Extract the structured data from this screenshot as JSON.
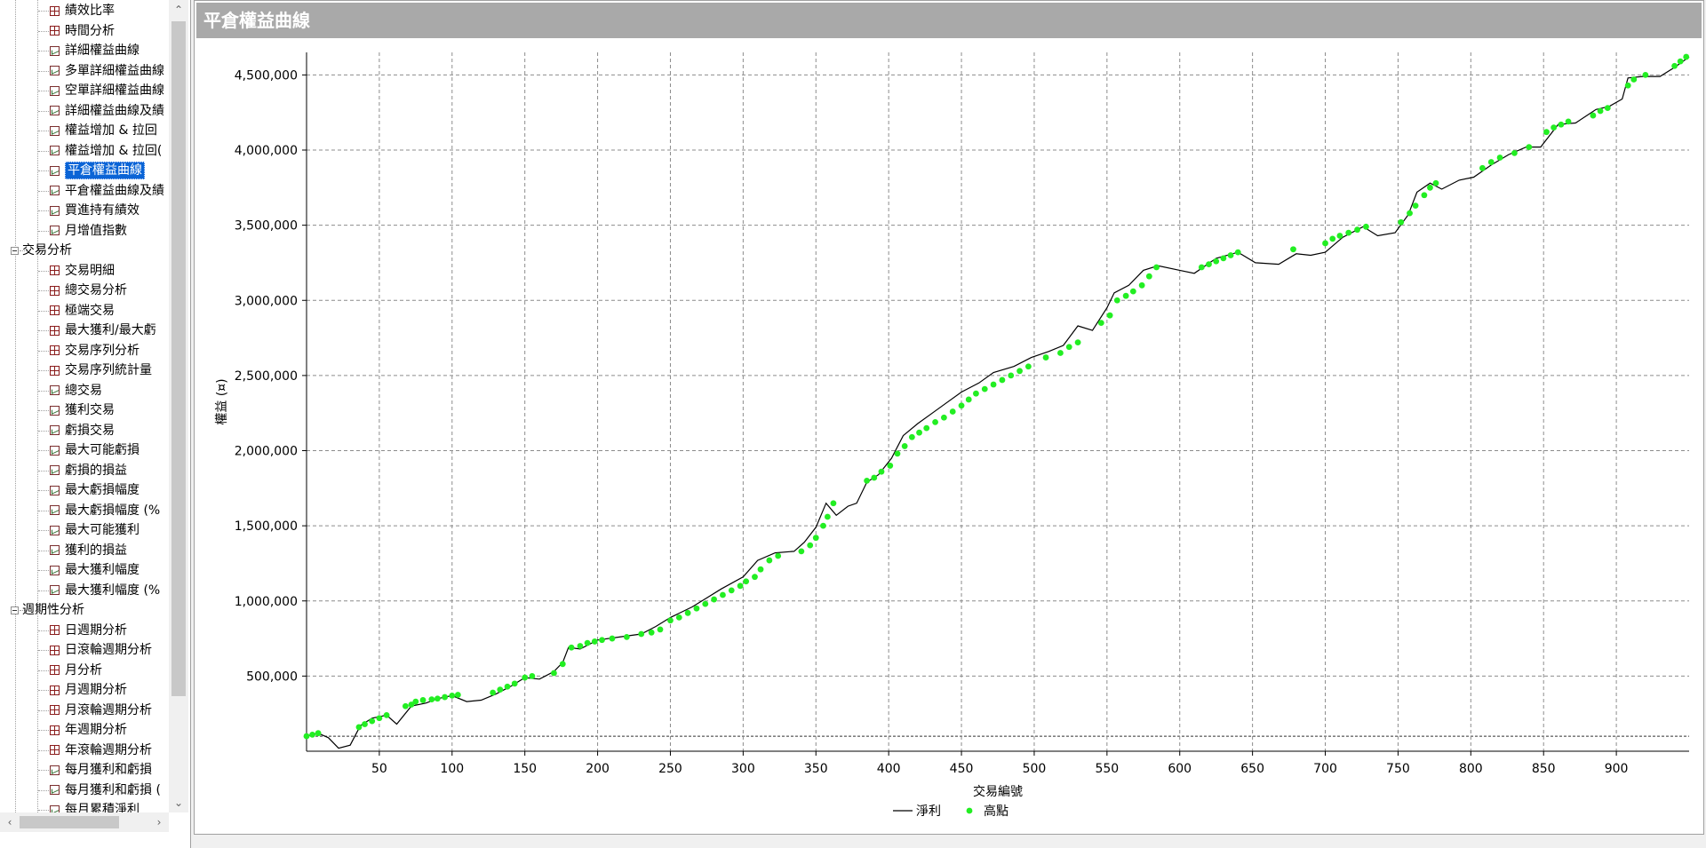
{
  "sidebar": {
    "items": [
      {
        "label": "績效比率",
        "icon": "grid-icon",
        "level": 2
      },
      {
        "label": "時間分析",
        "icon": "grid-icon",
        "level": 2
      },
      {
        "label": "詳細權益曲線",
        "icon": "chart-icon",
        "level": 2
      },
      {
        "label": "多單詳細權益曲線",
        "icon": "chart-icon",
        "level": 2
      },
      {
        "label": "空單詳細權益曲線",
        "icon": "chart-icon",
        "level": 2
      },
      {
        "label": "詳細權益曲線及績",
        "icon": "chart-icon",
        "level": 2
      },
      {
        "label": "權益增加 & 拉回",
        "icon": "chart-icon",
        "level": 2
      },
      {
        "label": "權益增加 & 拉回(",
        "icon": "chart-icon",
        "level": 2
      },
      {
        "label": "平倉權益曲線",
        "icon": "chart-icon",
        "level": 2,
        "selected": true
      },
      {
        "label": "平倉權益曲線及績",
        "icon": "chart-icon",
        "level": 2
      },
      {
        "label": "買進持有績效",
        "icon": "chart-icon",
        "level": 2
      },
      {
        "label": "月增值指數",
        "icon": "chart-icon",
        "level": 2
      },
      {
        "label": "交易分析",
        "icon": "expander",
        "level": 1
      },
      {
        "label": "交易明細",
        "icon": "grid-icon",
        "level": 2
      },
      {
        "label": "總交易分析",
        "icon": "grid-icon",
        "level": 2
      },
      {
        "label": "極端交易",
        "icon": "grid-icon",
        "level": 2
      },
      {
        "label": "最大獲利/最大虧",
        "icon": "grid-icon",
        "level": 2
      },
      {
        "label": "交易序列分析",
        "icon": "grid-icon",
        "level": 2
      },
      {
        "label": "交易序列統計量",
        "icon": "grid-icon",
        "level": 2
      },
      {
        "label": "總交易",
        "icon": "chart-icon",
        "level": 2
      },
      {
        "label": "獲利交易",
        "icon": "chart-icon",
        "level": 2
      },
      {
        "label": "虧損交易",
        "icon": "chart-icon",
        "level": 2
      },
      {
        "label": "最大可能虧損",
        "icon": "chart-icon",
        "level": 2
      },
      {
        "label": "虧損的損益",
        "icon": "chart-icon",
        "level": 2
      },
      {
        "label": "最大虧損幅度",
        "icon": "chart-icon",
        "level": 2
      },
      {
        "label": "最大虧損幅度 (%",
        "icon": "chart-icon",
        "level": 2
      },
      {
        "label": "最大可能獲利",
        "icon": "chart-icon",
        "level": 2
      },
      {
        "label": "獲利的損益",
        "icon": "chart-icon",
        "level": 2
      },
      {
        "label": "最大獲利幅度",
        "icon": "chart-icon",
        "level": 2
      },
      {
        "label": "最大獲利幅度 (%",
        "icon": "chart-icon",
        "level": 2
      },
      {
        "label": "週期性分析",
        "icon": "expander",
        "level": 1
      },
      {
        "label": "日週期分析",
        "icon": "grid-icon",
        "level": 2
      },
      {
        "label": "日滾輪週期分析",
        "icon": "grid-icon",
        "level": 2
      },
      {
        "label": "月分析",
        "icon": "grid-icon",
        "level": 2
      },
      {
        "label": "月週期分析",
        "icon": "grid-icon",
        "level": 2
      },
      {
        "label": "月滾輪週期分析",
        "icon": "grid-icon",
        "level": 2
      },
      {
        "label": "年週期分析",
        "icon": "grid-icon",
        "level": 2
      },
      {
        "label": "年滾輪週期分析",
        "icon": "grid-icon",
        "level": 2
      },
      {
        "label": "每月獲利和虧損",
        "icon": "chart-icon",
        "level": 2
      },
      {
        "label": "每月獲利和虧損 (",
        "icon": "chart-icon",
        "level": 2
      },
      {
        "label": "每月累積淨利",
        "icon": "chart-icon",
        "level": 2
      }
    ]
  },
  "scrollbar": {
    "up_icon": "chevron-up-icon",
    "down_icon": "chevron-down-icon",
    "left_icon": "chevron-left-icon",
    "right_icon": "chevron-right-icon",
    "up_glyph": "⌃",
    "down_glyph": "⌄",
    "left_glyph": "‹",
    "right_glyph": "›"
  },
  "panel": {
    "title": "平倉權益曲線"
  },
  "chart_data": {
    "type": "line",
    "xlabel": "交易編號",
    "ylabel": "權益 (¤)",
    "xlim": [
      0,
      950
    ],
    "ylim": [
      0,
      4650000
    ],
    "x_ticks": [
      50,
      100,
      150,
      200,
      250,
      300,
      350,
      400,
      450,
      500,
      550,
      600,
      650,
      700,
      750,
      800,
      850,
      900
    ],
    "y_ticks": [
      500000,
      1000000,
      1500000,
      2000000,
      2500000,
      3000000,
      3500000,
      4000000,
      4500000
    ],
    "y_tick_labels": [
      "500,000",
      "1,000,000",
      "1,500,000",
      "2,000,000",
      "2,500,000",
      "3,000,000",
      "3,500,000",
      "4,000,000",
      "4,500,000"
    ],
    "grid": true,
    "legend_position": "bottom",
    "colors": {
      "line": "#000000",
      "high": "#22ee22"
    },
    "series": [
      {
        "name": "淨利",
        "points": [
          [
            0,
            100000
          ],
          [
            8,
            120000
          ],
          [
            15,
            90000
          ],
          [
            22,
            20000
          ],
          [
            30,
            40000
          ],
          [
            37,
            170000
          ],
          [
            45,
            220000
          ],
          [
            55,
            240000
          ],
          [
            62,
            180000
          ],
          [
            72,
            300000
          ],
          [
            82,
            320000
          ],
          [
            90,
            350000
          ],
          [
            100,
            370000
          ],
          [
            110,
            330000
          ],
          [
            120,
            340000
          ],
          [
            130,
            380000
          ],
          [
            140,
            430000
          ],
          [
            150,
            490000
          ],
          [
            160,
            480000
          ],
          [
            170,
            530000
          ],
          [
            176,
            590000
          ],
          [
            180,
            690000
          ],
          [
            188,
            680000
          ],
          [
            200,
            740000
          ],
          [
            215,
            760000
          ],
          [
            230,
            780000
          ],
          [
            240,
            830000
          ],
          [
            250,
            890000
          ],
          [
            265,
            960000
          ],
          [
            275,
            1020000
          ],
          [
            285,
            1080000
          ],
          [
            300,
            1160000
          ],
          [
            310,
            1270000
          ],
          [
            322,
            1320000
          ],
          [
            335,
            1330000
          ],
          [
            342,
            1390000
          ],
          [
            350,
            1490000
          ],
          [
            357,
            1650000
          ],
          [
            364,
            1570000
          ],
          [
            372,
            1630000
          ],
          [
            378,
            1650000
          ],
          [
            385,
            1790000
          ],
          [
            393,
            1840000
          ],
          [
            402,
            1950000
          ],
          [
            410,
            2100000
          ],
          [
            420,
            2180000
          ],
          [
            430,
            2250000
          ],
          [
            440,
            2320000
          ],
          [
            450,
            2390000
          ],
          [
            462,
            2450000
          ],
          [
            472,
            2520000
          ],
          [
            486,
            2560000
          ],
          [
            498,
            2620000
          ],
          [
            510,
            2660000
          ],
          [
            520,
            2700000
          ],
          [
            530,
            2830000
          ],
          [
            540,
            2800000
          ],
          [
            550,
            2950000
          ],
          [
            555,
            3050000
          ],
          [
            565,
            3100000
          ],
          [
            575,
            3200000
          ],
          [
            585,
            3230000
          ],
          [
            600,
            3200000
          ],
          [
            610,
            3180000
          ],
          [
            625,
            3280000
          ],
          [
            640,
            3320000
          ],
          [
            652,
            3250000
          ],
          [
            668,
            3240000
          ],
          [
            680,
            3310000
          ],
          [
            690,
            3300000
          ],
          [
            700,
            3320000
          ],
          [
            712,
            3420000
          ],
          [
            726,
            3490000
          ],
          [
            736,
            3430000
          ],
          [
            748,
            3450000
          ],
          [
            757,
            3570000
          ],
          [
            763,
            3720000
          ],
          [
            772,
            3780000
          ],
          [
            780,
            3740000
          ],
          [
            792,
            3800000
          ],
          [
            802,
            3820000
          ],
          [
            814,
            3900000
          ],
          [
            826,
            3970000
          ],
          [
            838,
            4020000
          ],
          [
            848,
            4020000
          ],
          [
            860,
            4170000
          ],
          [
            872,
            4180000
          ],
          [
            886,
            4270000
          ],
          [
            895,
            4290000
          ],
          [
            904,
            4340000
          ],
          [
            908,
            4480000
          ],
          [
            918,
            4490000
          ],
          [
            930,
            4490000
          ],
          [
            940,
            4550000
          ],
          [
            950,
            4620000
          ]
        ]
      },
      {
        "name": "高點",
        "x": [
          0,
          4,
          8,
          36,
          40,
          45,
          50,
          55,
          68,
          72,
          75,
          80,
          86,
          90,
          95,
          100,
          104,
          128,
          133,
          138,
          143,
          150,
          155,
          170,
          176,
          182,
          188,
          193,
          198,
          203,
          210,
          220,
          230,
          237,
          243,
          250,
          256,
          262,
          268,
          274,
          280,
          286,
          292,
          298,
          302,
          308,
          312,
          318,
          324,
          340,
          346,
          350,
          355,
          358,
          362,
          385,
          390,
          395,
          401,
          406,
          411,
          416,
          421,
          426,
          432,
          438,
          444,
          450,
          455,
          460,
          466,
          472,
          478,
          484,
          490,
          496,
          508,
          518,
          524,
          530,
          546,
          552,
          557,
          563,
          568,
          574,
          579,
          584,
          615,
          620,
          625,
          630,
          635,
          640,
          678,
          700,
          705,
          710,
          716,
          722,
          728,
          752,
          758,
          762,
          768,
          772,
          776,
          808,
          814,
          820,
          830,
          840,
          852,
          857,
          862,
          867,
          884,
          889,
          894,
          908,
          912,
          920,
          940,
          944,
          948
        ],
        "values": [
          100000,
          110000,
          120000,
          160000,
          180000,
          200000,
          220000,
          240000,
          300000,
          310000,
          330000,
          340000,
          345000,
          350000,
          360000,
          370000,
          375000,
          390000,
          410000,
          430000,
          450000,
          490000,
          500000,
          520000,
          580000,
          690000,
          700000,
          720000,
          730000,
          740000,
          750000,
          760000,
          780000,
          790000,
          810000,
          870000,
          890000,
          920000,
          950000,
          980000,
          1010000,
          1040000,
          1070000,
          1100000,
          1130000,
          1160000,
          1210000,
          1270000,
          1300000,
          1330000,
          1370000,
          1420000,
          1500000,
          1560000,
          1650000,
          1800000,
          1820000,
          1860000,
          1900000,
          1980000,
          2030000,
          2090000,
          2120000,
          2150000,
          2190000,
          2220000,
          2260000,
          2300000,
          2340000,
          2380000,
          2410000,
          2440000,
          2470000,
          2500000,
          2530000,
          2560000,
          2620000,
          2650000,
          2690000,
          2720000,
          2850000,
          2900000,
          3000000,
          3030000,
          3060000,
          3100000,
          3160000,
          3220000,
          3220000,
          3240000,
          3260000,
          3280000,
          3300000,
          3320000,
          3340000,
          3380000,
          3410000,
          3430000,
          3450000,
          3470000,
          3490000,
          3520000,
          3580000,
          3630000,
          3700000,
          3750000,
          3780000,
          3880000,
          3920000,
          3950000,
          3980000,
          4020000,
          4120000,
          4150000,
          4170000,
          4190000,
          4230000,
          4260000,
          4280000,
          4430000,
          4470000,
          4500000,
          4560000,
          4590000,
          4620000
        ]
      }
    ]
  }
}
